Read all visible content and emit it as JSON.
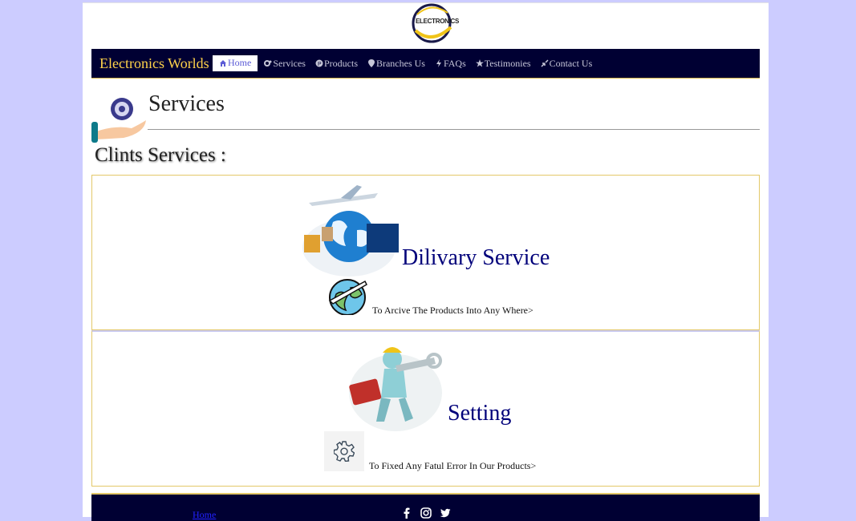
{
  "logo": {
    "text": "ELECTRONICS"
  },
  "navbar": {
    "brand": "Electronics Worlds",
    "items": [
      {
        "label": "Home",
        "icon": "home-icon",
        "active": true
      },
      {
        "label": "Services",
        "icon": "cogs-icon"
      },
      {
        "label": "Products",
        "icon": "product-icon"
      },
      {
        "label": "Branches Us",
        "icon": "map-marker-icon"
      },
      {
        "label": "FAQs",
        "icon": "bolt-icon"
      },
      {
        "label": "Testimonies",
        "icon": "star-icon"
      },
      {
        "label": "Contact Us",
        "icon": "compress-icon"
      }
    ]
  },
  "section": {
    "title": "Services",
    "subtitle": "Clints Services :"
  },
  "services": [
    {
      "title": "Dilivary Service",
      "description": "To Arcive The Products Into Any Where>",
      "image": "delivery-globe-image",
      "icon": "globe-plane-icon"
    },
    {
      "title": "Setting",
      "description": "To Fixed Any Fatul Error In Our Products>",
      "image": "repairman-image",
      "icon": "gear-icon"
    }
  ],
  "footer": {
    "link": "Home",
    "socials": [
      "facebook-icon",
      "instagram-icon",
      "twitter-icon"
    ]
  },
  "colors": {
    "background": "#ccccff",
    "nav": "#000033",
    "brand": "#ffd24a",
    "accent": "#00007a",
    "border": "#e3c869"
  }
}
